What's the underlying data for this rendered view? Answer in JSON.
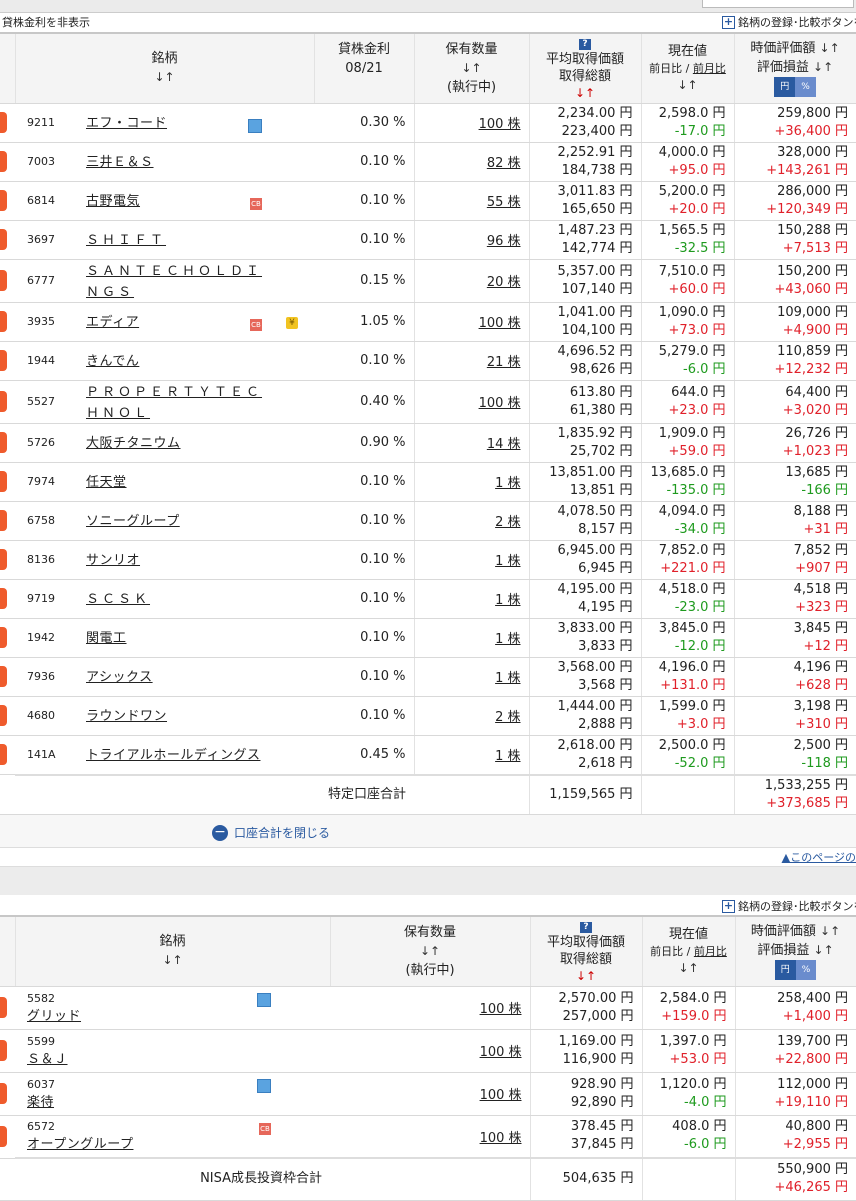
{
  "lending_toggle": "貸株金利を非表示",
  "register_label": "銘柄の登録･比較ボタンを",
  "page_top_link": "▲このページの",
  "close_total_label": "口座合計を閉じる",
  "header": {
    "stock": "銘柄",
    "sort": "↓↑",
    "lend_rate": "貸株金利",
    "lend_date": "08/21",
    "qty": "保有数量",
    "exec": "(執行中)",
    "avg_price": "平均取得価額",
    "total_cost": "取得総額",
    "cur_price": "現在値",
    "prev_day": "前日比",
    "sep": " / ",
    "prev_month": "前月比",
    "market_value": "時価評価額",
    "pl": "評価損益",
    "yen_btn": "円",
    "pct_btn": "%",
    "help": "?"
  },
  "tokutei": {
    "rows": [
      {
        "code": "9211",
        "name": "エフ・コード",
        "icon": "calendar-icon",
        "rate": "0.30 %",
        "qty": "100 株",
        "avg": "2,234.00 円",
        "cost": "223,400 円",
        "price": "2,598.0 円",
        "chg": "-17.0 円",
        "chg_dir": "down",
        "value": "259,800 円",
        "pl": "+36,400 円",
        "pl_dir": "up"
      },
      {
        "code": "7003",
        "name": "三井Ｅ＆Ｓ",
        "icon": "",
        "rate": "0.10 %",
        "qty": "82 株",
        "avg": "2,252.91 円",
        "cost": "184,738 円",
        "price": "4,000.0 円",
        "chg": "+95.0 円",
        "chg_dir": "up",
        "value": "328,000 円",
        "pl": "+143,261 円",
        "pl_dir": "up"
      },
      {
        "code": "6814",
        "name": "古野電気",
        "icon": "cb-icon",
        "rate": "0.10 %",
        "qty": "55 株",
        "avg": "3,011.83 円",
        "cost": "165,650 円",
        "price": "5,200.0 円",
        "chg": "+20.0 円",
        "chg_dir": "up",
        "value": "286,000 円",
        "pl": "+120,349 円",
        "pl_dir": "up"
      },
      {
        "code": "3697",
        "name": "ＳＨＩＦＴ",
        "icon": "",
        "rate": "0.10 %",
        "qty": "96 株",
        "avg": "1,487.23 円",
        "cost": "142,774 円",
        "price": "1,565.5 円",
        "chg": "-32.5 円",
        "chg_dir": "down",
        "value": "150,288 円",
        "pl": "+7,513 円",
        "pl_dir": "up"
      },
      {
        "code": "6777",
        "name": "ＳＡＮＴＥＣＨＯＬＤＩＮＧＳ",
        "icon": "",
        "rate": "0.15 %",
        "qty": "20 株",
        "avg": "5,357.00 円",
        "cost": "107,140 円",
        "price": "7,510.0 円",
        "chg": "+60.0 円",
        "chg_dir": "up",
        "value": "150,200 円",
        "pl": "+43,060 円",
        "pl_dir": "up"
      },
      {
        "code": "3935",
        "name": "エディア",
        "icon": "cb-icon",
        "icon2": "yen-icon",
        "rate": "1.05 %",
        "qty": "100 株",
        "avg": "1,041.00 円",
        "cost": "104,100 円",
        "price": "1,090.0 円",
        "chg": "+73.0 円",
        "chg_dir": "up",
        "value": "109,000 円",
        "pl": "+4,900 円",
        "pl_dir": "up"
      },
      {
        "code": "1944",
        "name": "きんでん",
        "icon": "",
        "rate": "0.10 %",
        "qty": "21 株",
        "avg": "4,696.52 円",
        "cost": "98,626 円",
        "price": "5,279.0 円",
        "chg": "-6.0 円",
        "chg_dir": "down",
        "value": "110,859 円",
        "pl": "+12,232 円",
        "pl_dir": "up"
      },
      {
        "code": "5527",
        "name": "ＰＲＯＰＥＲＴＹＴＥＣＨＮＯＬ",
        "icon": "",
        "rate": "0.40 %",
        "qty": "100 株",
        "avg": "613.80 円",
        "cost": "61,380 円",
        "price": "644.0 円",
        "chg": "+23.0 円",
        "chg_dir": "up",
        "value": "64,400 円",
        "pl": "+3,020 円",
        "pl_dir": "up"
      },
      {
        "code": "5726",
        "name": "大阪チタニウム",
        "icon": "",
        "rate": "0.90 %",
        "qty": "14 株",
        "avg": "1,835.92 円",
        "cost": "25,702 円",
        "price": "1,909.0 円",
        "chg": "+59.0 円",
        "chg_dir": "up",
        "value": "26,726 円",
        "pl": "+1,023 円",
        "pl_dir": "up"
      },
      {
        "code": "7974",
        "name": "任天堂",
        "icon": "",
        "rate": "0.10 %",
        "qty": "1 株",
        "avg": "13,851.00 円",
        "cost": "13,851 円",
        "price": "13,685.0 円",
        "chg": "-135.0 円",
        "chg_dir": "down",
        "value": "13,685 円",
        "pl": "-166 円",
        "pl_dir": "down"
      },
      {
        "code": "6758",
        "name": "ソニーグループ",
        "icon": "",
        "rate": "0.10 %",
        "qty": "2 株",
        "avg": "4,078.50 円",
        "cost": "8,157 円",
        "price": "4,094.0 円",
        "chg": "-34.0 円",
        "chg_dir": "down",
        "value": "8,188 円",
        "pl": "+31 円",
        "pl_dir": "up"
      },
      {
        "code": "8136",
        "name": "サンリオ",
        "icon": "",
        "rate": "0.10 %",
        "qty": "1 株",
        "avg": "6,945.00 円",
        "cost": "6,945 円",
        "price": "7,852.0 円",
        "chg": "+221.0 円",
        "chg_dir": "up",
        "value": "7,852 円",
        "pl": "+907 円",
        "pl_dir": "up"
      },
      {
        "code": "9719",
        "name": "ＳＣＳＫ",
        "icon": "",
        "rate": "0.10 %",
        "qty": "1 株",
        "avg": "4,195.00 円",
        "cost": "4,195 円",
        "price": "4,518.0 円",
        "chg": "-23.0 円",
        "chg_dir": "down",
        "value": "4,518 円",
        "pl": "+323 円",
        "pl_dir": "up"
      },
      {
        "code": "1942",
        "name": "関電工",
        "icon": "",
        "rate": "0.10 %",
        "qty": "1 株",
        "avg": "3,833.00 円",
        "cost": "3,833 円",
        "price": "3,845.0 円",
        "chg": "-12.0 円",
        "chg_dir": "down",
        "value": "3,845 円",
        "pl": "+12 円",
        "pl_dir": "up"
      },
      {
        "code": "7936",
        "name": "アシックス",
        "icon": "",
        "rate": "0.10 %",
        "qty": "1 株",
        "avg": "3,568.00 円",
        "cost": "3,568 円",
        "price": "4,196.0 円",
        "chg": "+131.0 円",
        "chg_dir": "up",
        "value": "4,196 円",
        "pl": "+628 円",
        "pl_dir": "up"
      },
      {
        "code": "4680",
        "name": "ラウンドワン",
        "icon": "",
        "rate": "0.10 %",
        "qty": "2 株",
        "avg": "1,444.00 円",
        "cost": "2,888 円",
        "price": "1,599.0 円",
        "chg": "+3.0 円",
        "chg_dir": "up",
        "value": "3,198 円",
        "pl": "+310 円",
        "pl_dir": "up"
      },
      {
        "code": "141A",
        "name": "トライアルホールディングス",
        "icon": "",
        "rate": "0.45 %",
        "qty": "1 株",
        "avg": "2,618.00 円",
        "cost": "2,618 円",
        "price": "2,500.0 円",
        "chg": "-52.0 円",
        "chg_dir": "down",
        "value": "2,500 円",
        "pl": "-118 円",
        "pl_dir": "down"
      }
    ],
    "total_label": "特定口座合計",
    "total_cost": "1,159,565 円",
    "total_value": "1,533,255 円",
    "total_pl": "+373,685 円"
  },
  "nisa": {
    "rows": [
      {
        "code": "5582",
        "name": "グリッド",
        "icon": "calendar-icon",
        "qty": "100 株",
        "avg": "2,570.00 円",
        "cost": "257,000 円",
        "price": "2,584.0 円",
        "chg": "+159.0 円",
        "chg_dir": "up",
        "value": "258,400 円",
        "pl": "+1,400 円",
        "pl_dir": "up"
      },
      {
        "code": "5599",
        "name": "Ｓ＆Ｊ",
        "icon": "",
        "qty": "100 株",
        "avg": "1,169.00 円",
        "cost": "116,900 円",
        "price": "1,397.0 円",
        "chg": "+53.0 円",
        "chg_dir": "up",
        "value": "139,700 円",
        "pl": "+22,800 円",
        "pl_dir": "up"
      },
      {
        "code": "6037",
        "name": "楽待",
        "icon": "calendar-icon",
        "qty": "100 株",
        "avg": "928.90 円",
        "cost": "92,890 円",
        "price": "1,120.0 円",
        "chg": "-4.0 円",
        "chg_dir": "down",
        "value": "112,000 円",
        "pl": "+19,110 円",
        "pl_dir": "up"
      },
      {
        "code": "6572",
        "name": "オープングループ",
        "icon": "cb-icon",
        "qty": "100 株",
        "avg": "378.45 円",
        "cost": "37,845 円",
        "price": "408.0 円",
        "chg": "-6.0 円",
        "chg_dir": "down",
        "value": "40,800 円",
        "pl": "+2,955 円",
        "pl_dir": "up"
      }
    ],
    "total_label": "NISA成長投資枠合計",
    "total_cost": "504,635 円",
    "total_value": "550,900 円",
    "total_pl": "+46,265 円"
  }
}
